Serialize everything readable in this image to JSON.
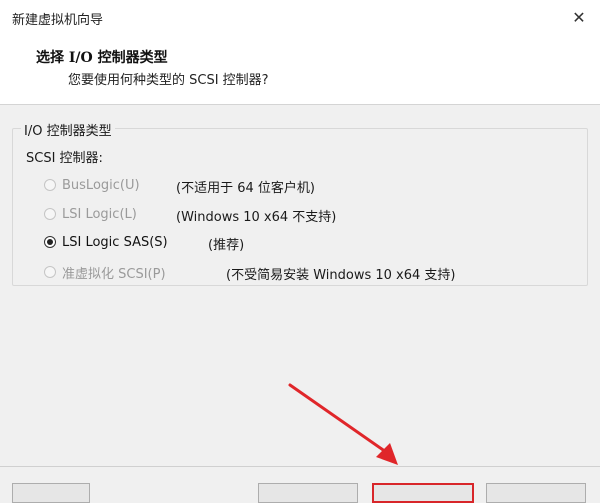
{
  "window": {
    "title": "新建虚拟机向导",
    "close_glyph": "✕"
  },
  "header": {
    "title": "选择 I/O 控制器类型",
    "subtitle": "您要使用何种类型的 SCSI 控制器?"
  },
  "group": {
    "legend": "I/O 控制器类型",
    "scsi_label": "SCSI 控制器:",
    "options": [
      {
        "label": "BusLogic(U)",
        "note": "(不适用于 64 位客户机)",
        "selected": false,
        "enabled": false
      },
      {
        "label": "LSI Logic(L)",
        "note": "(Windows 10 x64 不支持)",
        "selected": false,
        "enabled": false
      },
      {
        "label": "LSI Logic SAS(S)",
        "note": "(推荐)",
        "selected": true,
        "enabled": true
      },
      {
        "label": "准虚拟化 SCSI(P)",
        "note": "(不受简易安装 Windows 10 x64 支持)",
        "selected": false,
        "enabled": false
      }
    ]
  },
  "colors": {
    "annotation_arrow": "#e0262a",
    "highlight_border": "#d8262a"
  }
}
